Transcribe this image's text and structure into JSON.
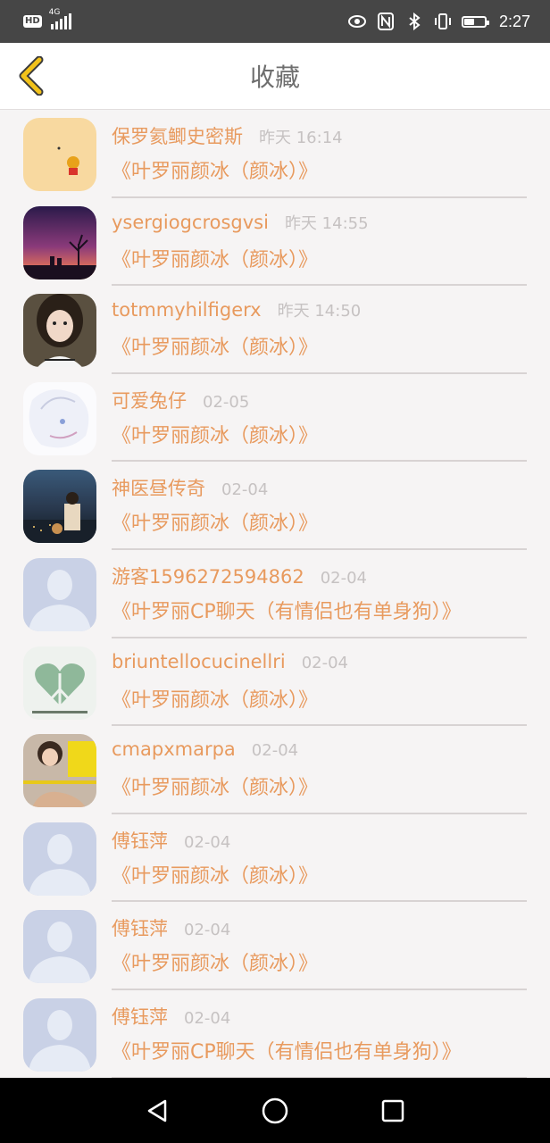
{
  "status_bar": {
    "hd": "HD",
    "network_type": "4G",
    "time": "2:27",
    "battery_level": 0.5
  },
  "header": {
    "title": "收藏",
    "back_icon": "chevron-left-icon"
  },
  "colors": {
    "accent": "#e89a5e",
    "back_icon": "#e6b800",
    "status_bar": "#464646",
    "time_text": "#c6c2c2"
  },
  "favorites": [
    {
      "user": "保罗氦鲫史密斯",
      "time": "昨天 16:14",
      "title": "《叶罗丽颜冰（颜冰）》",
      "avatar": "winnie-pooh-avatar"
    },
    {
      "user": "ysergiogcrosgvsi",
      "time": "昨天 14:55",
      "title": "《叶罗丽颜冰（颜冰）》",
      "avatar": "sunset-avatar"
    },
    {
      "user": "totmmyhilfigerx",
      "time": "昨天 14:50",
      "title": "《叶罗丽颜冰（颜冰）》",
      "avatar": "girl-portrait-avatar"
    },
    {
      "user": "可爱兔仔",
      "time": "02-05",
      "title": "《叶罗丽颜冰（颜冰）》",
      "avatar": "anime-avatar"
    },
    {
      "user": "神医昼传奇",
      "time": "02-04",
      "title": "《叶罗丽颜冰（颜冰）》",
      "avatar": "city-night-avatar"
    },
    {
      "user": "游客1596272594862",
      "time": "02-04",
      "title": "《叶罗丽CP聊天（有情侣也有单身狗）》",
      "avatar": "default-avatar"
    },
    {
      "user": "briuntellocucinellri",
      "time": "02-04",
      "title": "《叶罗丽颜冰（颜冰）》",
      "avatar": "heart-couple-avatar"
    },
    {
      "user": "cmapxmarpa",
      "time": "02-04",
      "title": "《叶罗丽颜冰（颜冰）》",
      "avatar": "yellow-girl-avatar"
    },
    {
      "user": "傅钰萍",
      "time": "02-04",
      "title": "《叶罗丽颜冰（颜冰）》",
      "avatar": "default-avatar"
    },
    {
      "user": "傅钰萍",
      "time": "02-04",
      "title": "《叶罗丽颜冰（颜冰）》",
      "avatar": "default-avatar"
    },
    {
      "user": "傅钰萍",
      "time": "02-04",
      "title": "《叶罗丽CP聊天（有情侣也有单身狗）》",
      "avatar": "default-avatar"
    }
  ],
  "nav_bar": {
    "back": "triangle-back-icon",
    "home": "circle-home-icon",
    "recents": "square-recents-icon"
  }
}
